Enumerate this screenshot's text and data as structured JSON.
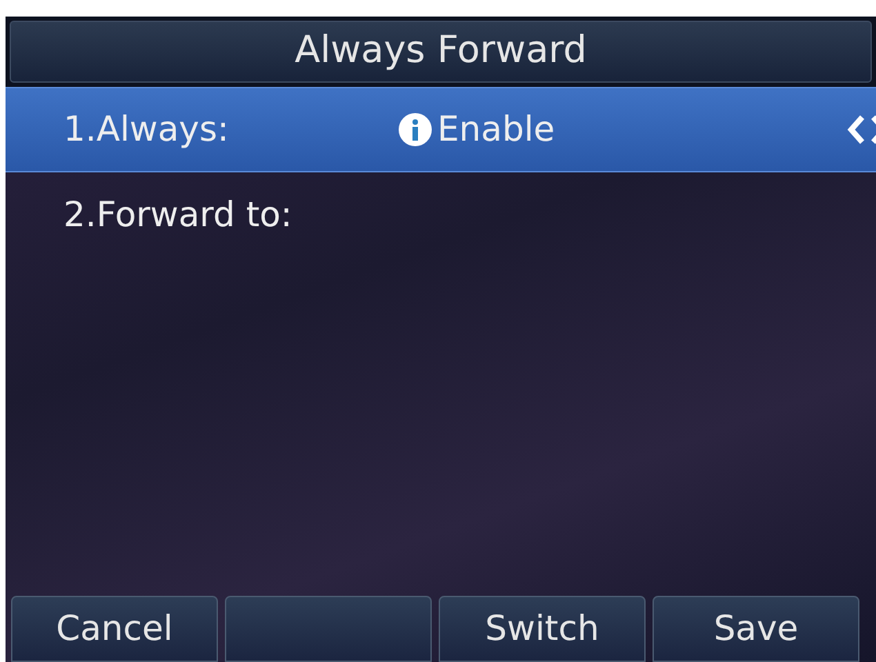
{
  "title": "Always Forward",
  "items": [
    {
      "label": "1.Always:",
      "value": "Enable",
      "info": true,
      "arrows": true,
      "selected": true
    },
    {
      "label": "2.Forward to:",
      "info": false,
      "arrows": false,
      "selected": false
    }
  ],
  "softkeys": [
    {
      "kind": "labeled",
      "label": "Cancel"
    },
    {
      "kind": "empty"
    },
    {
      "kind": "labeled",
      "label": "Switch"
    },
    {
      "kind": "labeled",
      "label": "Save"
    }
  ]
}
